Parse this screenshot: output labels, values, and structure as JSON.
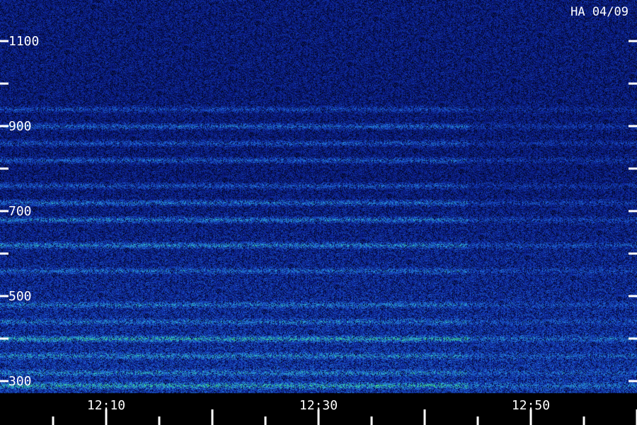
{
  "chart_data": {
    "type": "heatmap",
    "title": "",
    "xlabel": "",
    "ylabel": "",
    "station_stamp": "HA 04/09",
    "y_ticks": [
      "1100",
      "900",
      "700",
      "500",
      "300"
    ],
    "x_ticks": [
      "12:10",
      "12:30",
      "12:50"
    ],
    "colormap": [
      "#000000",
      "#0a1a8a",
      "#1e5fd6",
      "#2fb6c8",
      "#46e06a"
    ],
    "bands": [
      {
        "freq": 290,
        "intensity": 0.85
      },
      {
        "freq": 320,
        "intensity": 0.55
      },
      {
        "freq": 360,
        "intensity": 0.6
      },
      {
        "freq": 400,
        "intensity": 0.9
      },
      {
        "freq": 440,
        "intensity": 0.5
      },
      {
        "freq": 480,
        "intensity": 0.55
      },
      {
        "freq": 560,
        "intensity": 0.5
      },
      {
        "freq": 620,
        "intensity": 0.75
      },
      {
        "freq": 680,
        "intensity": 0.7
      },
      {
        "freq": 720,
        "intensity": 0.65
      },
      {
        "freq": 760,
        "intensity": 0.5
      },
      {
        "freq": 820,
        "intensity": 0.55
      },
      {
        "freq": 860,
        "intensity": 0.5
      },
      {
        "freq": 900,
        "intensity": 0.6
      },
      {
        "freq": 940,
        "intensity": 0.4
      }
    ]
  }
}
